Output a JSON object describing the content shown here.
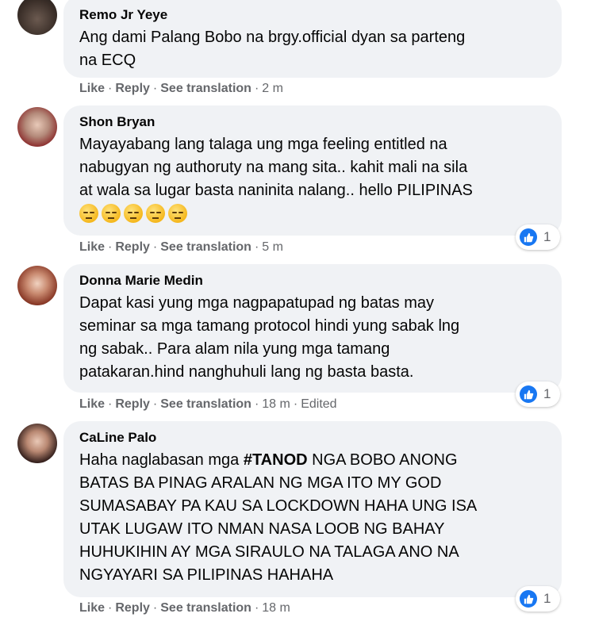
{
  "comments": [
    {
      "author": "Remo Jr Yeye",
      "lines": [
        "Ang dami Palang Bobo na brgy.official dyan sa parteng",
        "na ECQ"
      ],
      "actions": {
        "like": "Like",
        "reply": "Reply",
        "translate": "See translation",
        "time": "2 m",
        "edited": ""
      },
      "reactions": ""
    },
    {
      "author": "Shon Bryan",
      "lines": [
        "Mayayabang lang talaga ung mga feeling entitled na",
        "nabugyan ng authoruty na mang sita.. kahit mali na sila",
        "at wala sa lugar basta naninita nalang.. hello PILIPINAS"
      ],
      "emojis": [
        "sad-face-icon",
        "sad-face-icon",
        "sad-face-icon",
        "sad-face-icon",
        "sad-face-icon"
      ],
      "actions": {
        "like": "Like",
        "reply": "Reply",
        "translate": "See translation",
        "time": "5 m",
        "edited": ""
      },
      "reactions": "1"
    },
    {
      "author": "Donna Marie Medin",
      "lines": [
        "Dapat kasi yung mga nagpapatupad ng batas may",
        "seminar sa mga tamang protocol hindi yung sabak lng",
        "ng sabak.. Para alam nila yung mga tamang",
        "patakaran.hind nanghuhuli lang ng basta basta."
      ],
      "actions": {
        "like": "Like",
        "reply": "Reply",
        "translate": "See translation",
        "time": "18 m",
        "edited": "Edited"
      },
      "reactions": "1"
    },
    {
      "author": "CaLine Palo",
      "hashtag": "#TANOD",
      "first_line_rest": " NGA BOBO ANONG",
      "lines": [
        "BATAS BA PINAG ARALAN NG MGA ITO MY GOD",
        "SUMASABAY PA KAU SA LOCKDOWN HAHA UNG ISA",
        "UTAK LUGAW ITO NMAN NASA LOOB NG BAHAY",
        "HUHUKIHIN AY MGA SIRAULO NA TALAGA ANO NA",
        "NGYAYARI SA PILIPINAS HAHAHA"
      ],
      "first_line_prefix": "Haha naglabasan mga ",
      "actions": {
        "like": "Like",
        "reply": "Reply",
        "translate": "See translation",
        "time": "18 m",
        "edited": ""
      },
      "reactions": "1"
    }
  ],
  "separator": "·",
  "colors": {
    "bubble": "#f0f2f5",
    "meta": "#65676b",
    "like_blue": "#1877f2"
  }
}
